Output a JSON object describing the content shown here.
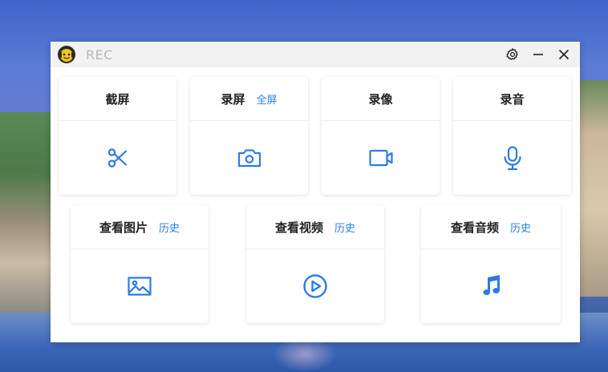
{
  "window": {
    "title": "REC"
  },
  "colors": {
    "accent": "#2d7be5",
    "titlebar_bg": "#f2f2f2",
    "title_text": "#b8b8b8"
  },
  "titlebar": {
    "settings_icon": "gear-icon",
    "minimize_icon": "minimize-icon",
    "close_icon": "close-icon"
  },
  "capture_cards": [
    {
      "label": "截屏",
      "link": "",
      "icon": "scissors-icon"
    },
    {
      "label": "录屏",
      "link": "全屏",
      "icon": "camera-icon"
    },
    {
      "label": "录像",
      "link": "",
      "icon": "video-camera-icon"
    },
    {
      "label": "录音",
      "link": "",
      "icon": "microphone-icon"
    }
  ],
  "view_cards": [
    {
      "label": "查看图片",
      "link": "历史",
      "icon": "image-icon"
    },
    {
      "label": "查看视频",
      "link": "历史",
      "icon": "play-circle-icon"
    },
    {
      "label": "查看音频",
      "link": "历史",
      "icon": "music-note-icon"
    }
  ]
}
